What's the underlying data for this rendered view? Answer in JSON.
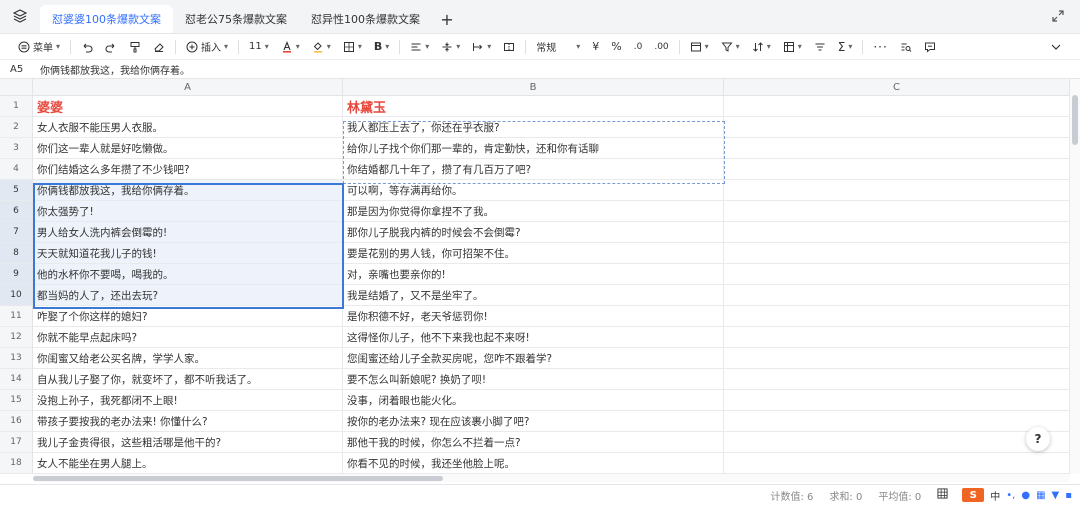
{
  "tabs": [
    {
      "label": "怼婆婆100条爆款文案",
      "active": true
    },
    {
      "label": "怼老公75条爆款文案",
      "active": false
    },
    {
      "label": "怼异性100条爆款文案",
      "active": false
    }
  ],
  "toolbar": {
    "menu_label": "菜单",
    "insert_label": "插入",
    "font_size": "11",
    "number_format": "常规"
  },
  "formula_bar": {
    "cell_ref": "A5",
    "value": "你俩钱都放我这，我给你俩存着。"
  },
  "columns": [
    "A",
    "B",
    "C"
  ],
  "rows": [
    {
      "n": "1",
      "a": "婆婆",
      "b": "林黛玉"
    },
    {
      "n": "2",
      "a": "女人衣服不能压男人衣服。",
      "b": "我人都压上去了，你还在乎衣服?"
    },
    {
      "n": "3",
      "a": "你们这一辈人就是好吃懒做。",
      "b": "给你儿子找个你们那一辈的，肯定勤快，还和你有话聊"
    },
    {
      "n": "4",
      "a": "你们结婚这么多年攒了不少钱吧?",
      "b": "你结婚都几十年了，攒了有几百万了吧?"
    },
    {
      "n": "5",
      "a": "你俩钱都放我这，我给你俩存着。",
      "b": "可以啊，等存满再给你。"
    },
    {
      "n": "6",
      "a": "你太强势了!",
      "b": "那是因为你觉得你拿捏不了我。"
    },
    {
      "n": "7",
      "a": "男人给女人洗内裤会倒霉的!",
      "b": "那你儿子脱我内裤的时候会不会倒霉?"
    },
    {
      "n": "8",
      "a": "天天就知道花我儿子的钱!",
      "b": "要是花别的男人钱，你可招架不住。"
    },
    {
      "n": "9",
      "a": "他的水杯你不要喝，喝我的。",
      "b": "对，亲嘴也要亲你的!"
    },
    {
      "n": "10",
      "a": "都当妈的人了，还出去玩?",
      "b": "我是结婚了，又不是坐牢了。"
    },
    {
      "n": "11",
      "a": "咋娶了个你这样的媳妇?",
      "b": "是你积德不好，老天爷惩罚你!"
    },
    {
      "n": "12",
      "a": "你就不能早点起床吗?",
      "b": "这得怪你儿子，他不下来我也起不来呀!"
    },
    {
      "n": "13",
      "a": "你闺蜜又给老公买名牌，学学人家。",
      "b": "您闺蜜还给儿子全款买房呢，您咋不跟着学?"
    },
    {
      "n": "14",
      "a": "自从我儿子娶了你，就变坏了，都不听我话了。",
      "b": "要不怎么叫新娘呢? 换奶了呗!"
    },
    {
      "n": "15",
      "a": "没抱上孙子，我死都闭不上眼!",
      "b": "没事，闭着眼也能火化。"
    },
    {
      "n": "16",
      "a": "带孩子要按我的老办法来! 你懂什么?",
      "b": "按你的老办法来? 现在应该裹小脚了吧?"
    },
    {
      "n": "17",
      "a": "我儿子金贵得很，这些粗活哪是他干的?",
      "b": "那他干我的时候，你怎么不拦着一点?"
    },
    {
      "n": "18",
      "a": "女人不能坐在男人腿上。",
      "b": "你看不见的时候，我还坐他脸上呢。"
    }
  ],
  "status_bar": {
    "count": "计数值: 6",
    "sum": "求和: 0",
    "average": "平均值: 0",
    "ime_logo": "S",
    "ime_mode": "中"
  },
  "colors": {
    "accent": "#3370ff",
    "header_red": "#e8473c",
    "selection_border": "#3c78d8"
  }
}
